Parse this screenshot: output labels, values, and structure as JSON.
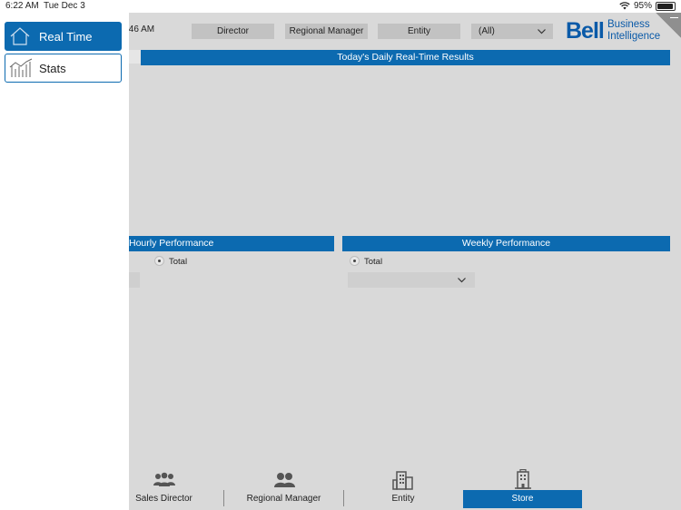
{
  "status_bar": {
    "time": "6:22 AM",
    "date": "Tue Dec 3",
    "battery": "95%"
  },
  "header": {
    "time_text": ":46 AM",
    "filters": {
      "director": "Director",
      "regional_manager": "Regional Manager",
      "entity": "Entity",
      "select_value": "(All)"
    },
    "logo": {
      "brand": "Bell",
      "line1": "Business",
      "line2": "Intelligence"
    }
  },
  "main": {
    "banner_title": "Today's Daily Real-Time Results",
    "hourly": {
      "title": "Hourly Performance",
      "radio_label": "Total"
    },
    "weekly": {
      "title": "Weekly Performance",
      "radio_label": "Total"
    }
  },
  "tabs": [
    {
      "label": "Sales Director",
      "icon": "group-icon"
    },
    {
      "label": "Regional Manager",
      "icon": "people-icon"
    },
    {
      "label": "Entity",
      "icon": "building-icon"
    },
    {
      "label": "Store",
      "icon": "store-building-icon",
      "active": true
    }
  ],
  "drawer": [
    {
      "label": "Real Time",
      "icon": "home-icon",
      "active": true
    },
    {
      "label": "Stats",
      "icon": "chart-icon",
      "active": false
    }
  ],
  "colors": {
    "accent": "#0c6ab0",
    "brand": "#0a5aa8",
    "background": "#d9d9d9"
  }
}
